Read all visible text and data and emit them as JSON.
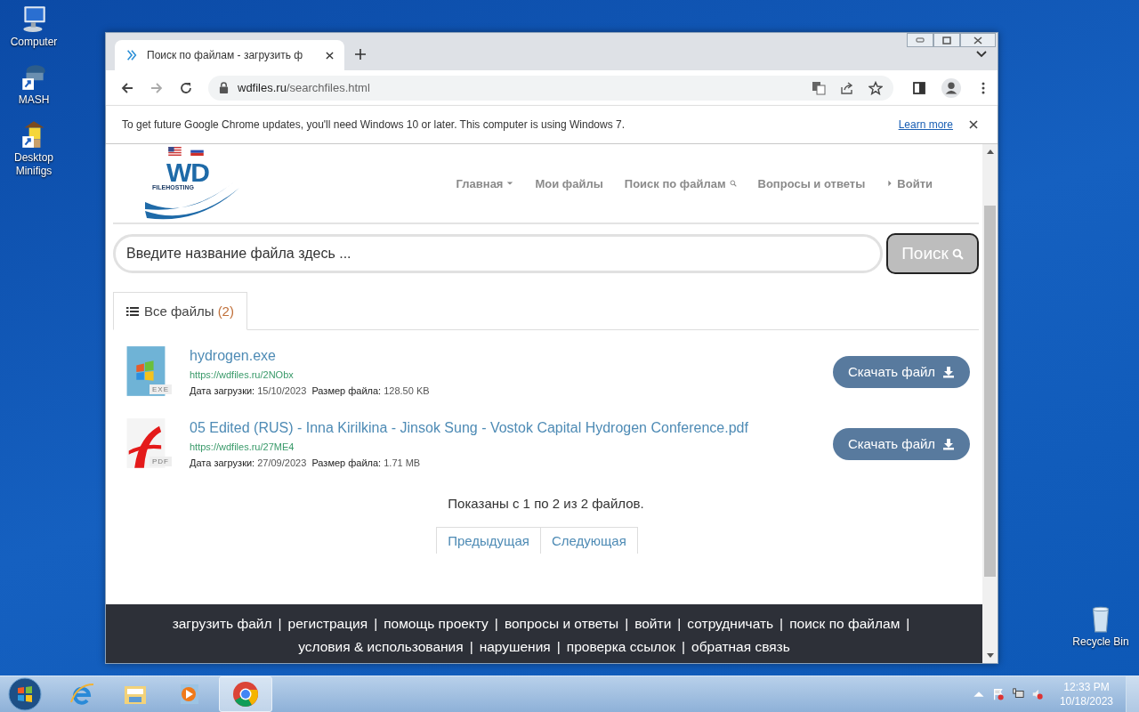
{
  "desktop_icons": [
    {
      "label": "Computer"
    },
    {
      "label": "MASH"
    },
    {
      "label": "Desktop Minifigs"
    }
  ],
  "recycle_bin": {
    "label": "Recycle Bin"
  },
  "browser": {
    "tab": {
      "title": "Поиск по файлам - загрузить ф",
      "selected": true
    },
    "address": {
      "host": "wdfiles.ru",
      "path": "/searchfiles.html"
    },
    "infobar": {
      "text": "To get future Google Chrome updates, you'll need Windows 10 or later. This computer is using Windows 7.",
      "link": "Learn more"
    }
  },
  "site": {
    "logo": {
      "title": "WD",
      "subtitle": "FILEHOSTING"
    },
    "nav": [
      {
        "label": "Главная",
        "kind": "dropdown"
      },
      {
        "label": "Мои файлы",
        "kind": "plain"
      },
      {
        "label": "Поиск по файлам",
        "kind": "search"
      },
      {
        "label": "Вопросы и ответы",
        "kind": "plain"
      },
      {
        "label": "Войти",
        "kind": "arrow"
      }
    ],
    "search": {
      "placeholder": "Введите название файла здесь ...",
      "button": "Поиск"
    },
    "tabs": [
      {
        "label": "Все файлы",
        "count": "(2)",
        "selected": true
      }
    ],
    "files": [
      {
        "kind": "exe",
        "badge": "EXE",
        "name": "hydrogen.exe",
        "url": "https://wdfiles.ru/2NObx",
        "date_label": "Дата загрузки:",
        "date": "15/10/2023",
        "size_label": "Размер файла:",
        "size": "128.50 KB",
        "button": "Скачать файл"
      },
      {
        "kind": "pdf",
        "badge": "PDF",
        "name": "05 Edited (RUS) - Inna Kirilkina - Jinsok Sung - Vostok Capital Hydrogen Conference.pdf",
        "url": "https://wdfiles.ru/27ME4",
        "date_label": "Дата загрузки:",
        "date": "27/09/2023",
        "size_label": "Размер файла:",
        "size": "1.71 MB",
        "button": "Скачать файл"
      }
    ],
    "summary": "Показаны с 1 по 2 из 2 файлов.",
    "pagination": [
      {
        "label": "Предыдущая"
      },
      {
        "label": "Следующая"
      }
    ],
    "footer": {
      "separator": "|",
      "links": [
        "загрузить файл",
        "регистрация",
        "помощь проекту",
        "вопросы и ответы",
        "войти",
        "сотрудничать",
        "поиск по файлам",
        "условия & использования",
        "нарушения",
        "проверка ссылок",
        "обратная связь"
      ]
    }
  },
  "taskbar": {
    "time": "12:33 PM",
    "date": "10/18/2023"
  }
}
